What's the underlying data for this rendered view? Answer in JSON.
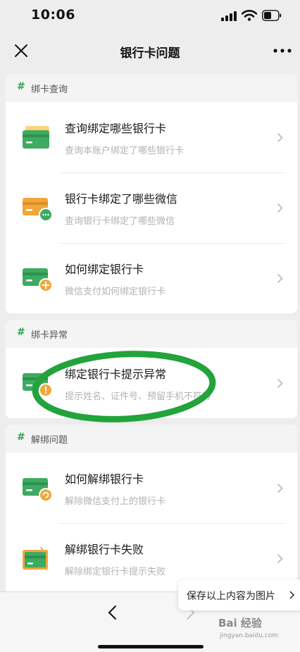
{
  "status": {
    "time": "10:06"
  },
  "nav": {
    "title": "银行卡问题"
  },
  "sections": [
    {
      "label": "绑卡查询",
      "items": [
        {
          "title": "查询绑定哪些银行卡",
          "subtitle": "查询本账户绑定了哪些银行卡",
          "icon": "bank-card-icon"
        },
        {
          "title": "银行卡绑定了哪些微信",
          "subtitle": "查询银行卡绑定了哪些微信",
          "icon": "card-wechat-icon"
        },
        {
          "title": "如何绑定银行卡",
          "subtitle": "微信支付如何绑定银行卡",
          "icon": "card-add-icon"
        }
      ]
    },
    {
      "label": "绑卡异常",
      "items": [
        {
          "title": "绑定银行卡提示异常",
          "subtitle": "提示姓名、证件号、预留手机不符等",
          "icon": "card-warning-icon"
        }
      ]
    },
    {
      "label": "解绑问题",
      "items": [
        {
          "title": "如何解绑银行卡",
          "subtitle": "解除微信支付上的银行卡",
          "icon": "card-unbind-icon"
        },
        {
          "title": "解绑银行卡失败",
          "subtitle": "解除绑定银行卡提示失败",
          "icon": "card-fail-icon"
        }
      ]
    }
  ],
  "save_popup": {
    "label": "保存以上内容为图片"
  },
  "watermark": {
    "brand": "Bai 经验",
    "sub": "jingyan.baidu.com"
  },
  "colors": {
    "accent": "#2fa24d",
    "card_green": "#3dab62",
    "card_orange": "#f0a63a",
    "annotation": "#22a33c"
  }
}
